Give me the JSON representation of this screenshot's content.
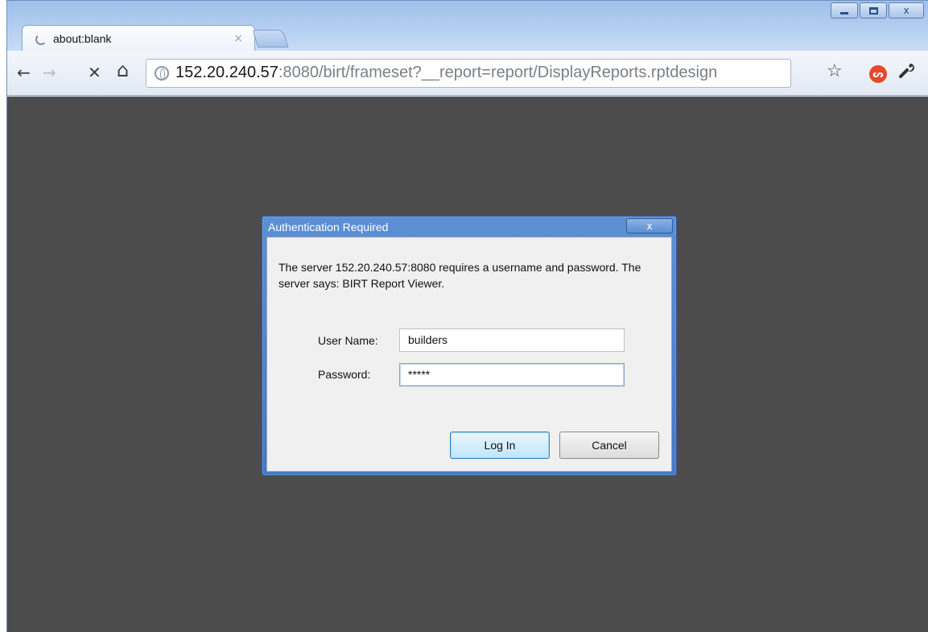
{
  "browser": {
    "tab": {
      "title": "about:blank",
      "close_glyph": "×"
    },
    "window_controls": {
      "minimize": "minimize-icon",
      "maximize": "maximize-icon",
      "close": "x"
    },
    "toolbar": {
      "back_icon": "←",
      "forward_icon": "→",
      "stop_icon": "✕",
      "home_icon": "⌂",
      "url_host": "152.20.240.57",
      "url_path": ":8080/birt/frameset?__report=report/DisplayReports.rptdesign",
      "star_icon": "☆",
      "extension_badge": "ᔕ",
      "wrench_icon": "🔧"
    }
  },
  "dialog": {
    "title": "Authentication Required",
    "close_label": "x",
    "message": "The server 152.20.240.57:8080 requires a username and password. The server says: BIRT Report Viewer.",
    "username_label": "User Name:",
    "username_value": "builders",
    "password_label": "Password:",
    "password_value": "*****",
    "login_label": "Log In",
    "cancel_label": "Cancel"
  },
  "colors": {
    "content_bg": "#4c4c4c",
    "dialog_titlebar": "#4678c3",
    "extension_badge": "#e7482b"
  }
}
